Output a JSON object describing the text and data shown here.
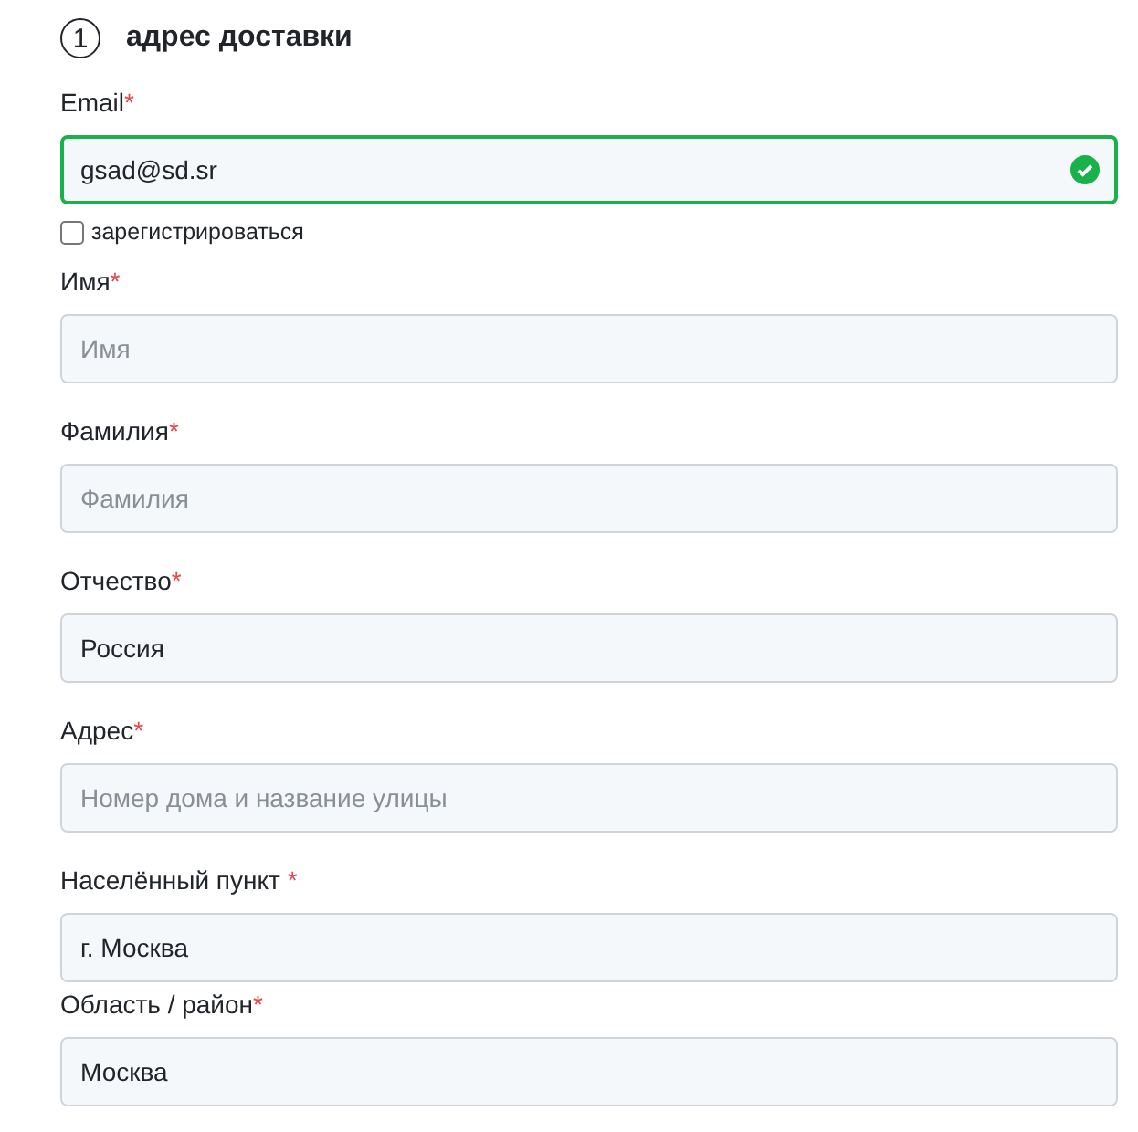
{
  "section": {
    "number": "1",
    "title": "адрес доставки"
  },
  "fields": [
    {
      "label": "Email",
      "required": "*",
      "value": "gsad@sd.sr",
      "valid": true,
      "checkbox": {
        "label": "зарегистрироваться",
        "checked": false
      }
    },
    {
      "label": "Имя",
      "required": "*",
      "placeholder": "Имя",
      "valid": false
    },
    {
      "label": "Фамилия",
      "required": "*",
      "placeholder": "Фамилия",
      "valid": false
    },
    {
      "label": "Отчество",
      "required": "*",
      "value": "Россия",
      "valid": false
    },
    {
      "label": "Адрес",
      "required": "*",
      "placeholder": "Номер дома и название улицы",
      "valid": false
    },
    {
      "label": "Населённый пункт ",
      "required": "*",
      "value": "г. Москва",
      "valid": false
    },
    {
      "label": "Область / район",
      "required": "*",
      "value": "Москва",
      "valid": false
    }
  ]
}
